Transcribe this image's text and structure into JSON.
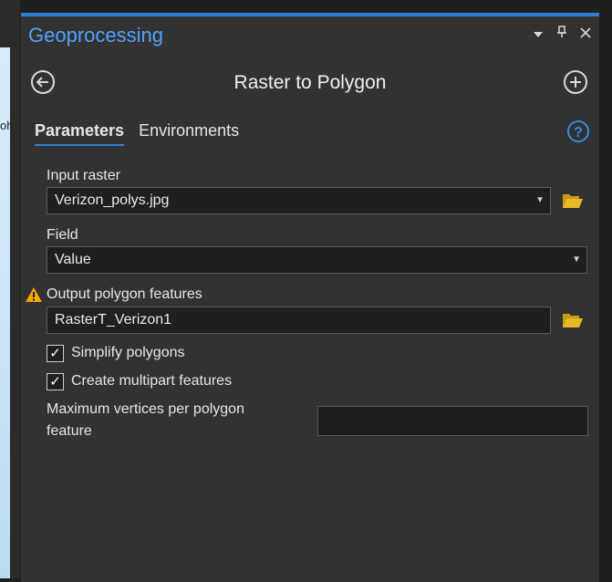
{
  "left_strip": {
    "fragment": "oh"
  },
  "panel": {
    "title": "Geoprocessing",
    "window_controls": [
      "▾",
      "⊓",
      "✕"
    ],
    "tool_title": "Raster to Polygon",
    "tabs": [
      {
        "label": "Parameters",
        "active": true
      },
      {
        "label": "Environments",
        "active": false
      }
    ],
    "params": {
      "input_raster": {
        "label": "Input raster",
        "value": "Verizon_polys.jpg"
      },
      "field": {
        "label": "Field",
        "value": "Value"
      },
      "output": {
        "label": "Output polygon features",
        "value": "RasterT_Verizon1"
      },
      "simplify": {
        "label": "Simplify polygons",
        "checked": true
      },
      "multipart": {
        "label": "Create multipart features",
        "checked": true
      },
      "max_vertices": {
        "label_line1": "Maximum vertices per polygon",
        "label_line2": "feature",
        "value": ""
      }
    },
    "colors": {
      "accent": "#2f7fd4",
      "title": "#4ea3ff",
      "folder": "#e8b923",
      "warning": "#f2a800"
    },
    "icons": {
      "back": "back-arrow-circle-icon",
      "add": "plus-circle-icon",
      "help": "help-question-icon",
      "folder": "open-folder-icon",
      "warning": "warning-triangle-icon"
    }
  }
}
